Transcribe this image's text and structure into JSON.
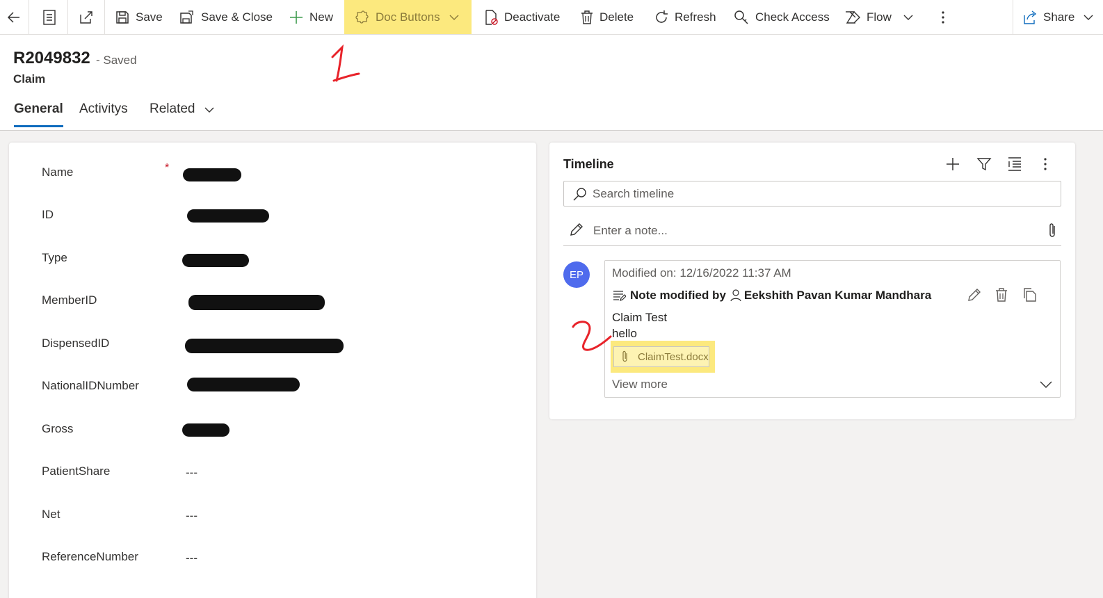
{
  "command_bar": {
    "save": "Save",
    "save_close": "Save & Close",
    "new": "New",
    "doc_buttons": "Doc Buttons",
    "deactivate": "Deactivate",
    "delete": "Delete",
    "refresh": "Refresh",
    "check_access": "Check Access",
    "flow": "Flow",
    "share": "Share"
  },
  "record": {
    "id": "R2049832",
    "status": "- Saved",
    "entity": "Claim"
  },
  "tabs": [
    {
      "label": "General",
      "active": true
    },
    {
      "label": "Activitys",
      "active": false
    },
    {
      "label": "Related",
      "active": false
    }
  ],
  "form": {
    "fields": [
      {
        "label": "Name",
        "required": true,
        "value": ""
      },
      {
        "label": "ID",
        "value": ""
      },
      {
        "label": "Type",
        "value": ""
      },
      {
        "label": "MemberID",
        "value": ""
      },
      {
        "label": "DispensedID",
        "value": ""
      },
      {
        "label": "NationalIDNumber",
        "value": ""
      },
      {
        "label": "Gross",
        "value": ""
      },
      {
        "label": "PatientShare",
        "value": "---"
      },
      {
        "label": "Net",
        "value": "---"
      },
      {
        "label": "ReferenceNumber",
        "value": "---"
      }
    ],
    "required_mark": "*"
  },
  "timeline": {
    "title": "Timeline",
    "search_placeholder": "Search timeline",
    "note_placeholder": "Enter a note...",
    "post": {
      "avatar_initials": "EP",
      "modified": "Modified on: 12/16/2022 11:37 AM",
      "action": "Note modified by",
      "author": "Eekshith Pavan Kumar Mandhara",
      "subject": "Claim Test",
      "body": "hello",
      "attachment": "ClaimTest.docx",
      "view_more": "View more"
    }
  },
  "colors": {
    "highlight": "#fce97e",
    "accent": "#0f6cbd",
    "avatar": "#4f6bed",
    "annotation": "#e8232a"
  }
}
